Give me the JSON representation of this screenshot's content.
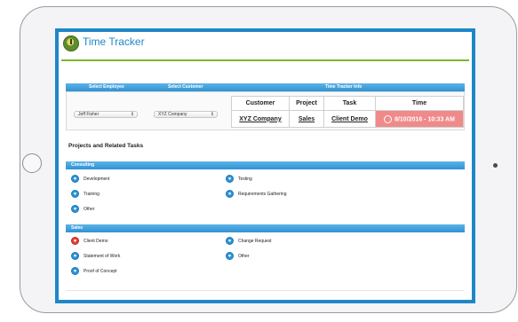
{
  "app": {
    "title": "Time Tracker"
  },
  "top_table": {
    "headers": {
      "employee": "Select Employee",
      "customer": "Select Customer",
      "info": "Time Tracker Info"
    },
    "employee_select": {
      "value": "Jeff Fisher"
    },
    "customer_select": {
      "value": "XYZ Company"
    },
    "info_columns": [
      "Customer",
      "Project",
      "Task",
      "Time"
    ],
    "info_row": {
      "customer": "XYZ Company",
      "project": "Sales",
      "task": "Client Demo",
      "time": "8/10/2016 - 10:33 AM"
    }
  },
  "projects": {
    "title": "Projects and Related Tasks",
    "groups": [
      {
        "name": "Consulting",
        "tasks": [
          "Development",
          "Testing",
          "Training",
          "Requirements Gathering",
          "Other"
        ]
      },
      {
        "name": "Sales",
        "tasks": [
          "Client Demo",
          "Change Request",
          "Statement of Work",
          "Other",
          "Proof of Concept"
        ]
      }
    ],
    "active_task": "Client Demo"
  },
  "colors": {
    "accent": "#1f86c8",
    "header_rule": "#7ab829",
    "active_time": "#f08a8a",
    "active_task": "#e0453a"
  },
  "icons": {
    "logo": "clock-logo",
    "task": "task-radio-icon",
    "timer": "clock-icon"
  }
}
